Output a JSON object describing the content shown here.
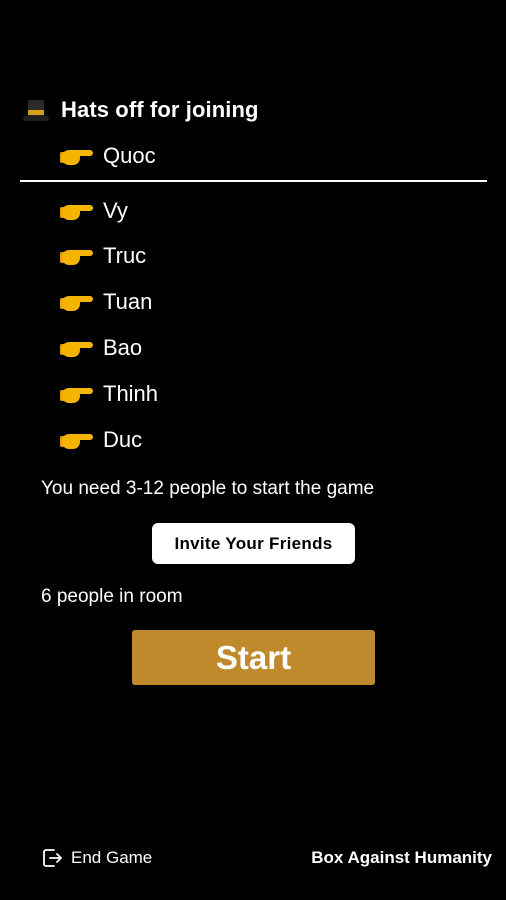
{
  "header": {
    "icon": "top-hat-icon",
    "title": "Hats off for joining"
  },
  "host": {
    "icon": "pointing-hand-icon",
    "name": "Quoc"
  },
  "players": [
    {
      "icon": "pointing-hand-icon",
      "name": "Vy"
    },
    {
      "icon": "pointing-hand-icon",
      "name": "Truc"
    },
    {
      "icon": "pointing-hand-icon",
      "name": "Tuan"
    },
    {
      "icon": "pointing-hand-icon",
      "name": "Bao"
    },
    {
      "icon": "pointing-hand-icon",
      "name": "Thinh"
    },
    {
      "icon": "pointing-hand-icon",
      "name": "Duc"
    }
  ],
  "notice": "You need 3-12 people to start the game",
  "invite_label": "Invite Your Friends",
  "room_count": "6 people in room",
  "start_label": "Start",
  "footer": {
    "end_icon": "exit-icon",
    "end_label": "End Game",
    "brand": "Box Against Humanity"
  },
  "colors": {
    "background": "#000000",
    "start_button": "#c08a2c",
    "invite_button": "#ffffff",
    "text": "#ffffff",
    "hand_emoji": "#f4b400"
  }
}
